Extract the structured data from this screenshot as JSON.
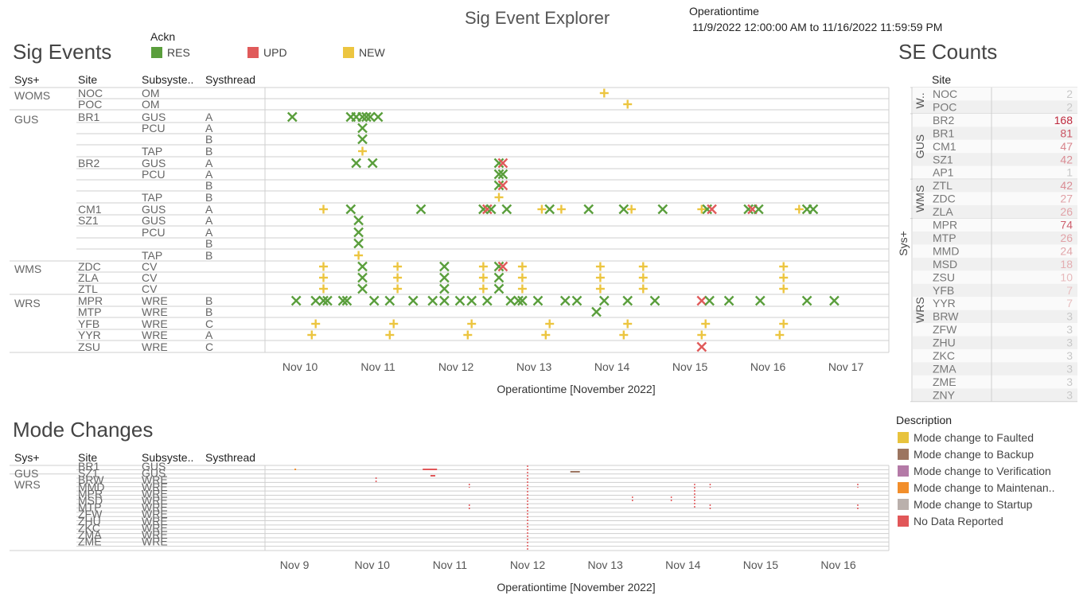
{
  "header": {
    "title": "Sig Event Explorer",
    "range_label": "Operationtime",
    "range_value": "11/9/2022 12:00:00 AM to 11/16/2022 11:59:59 PM"
  },
  "sig_events": {
    "title": "Sig Events",
    "legend_title": "Ackn",
    "legend": [
      {
        "name": "RES",
        "color": "#5a9e3c"
      },
      {
        "name": "UPD",
        "color": "#e05a5a"
      },
      {
        "name": "NEW",
        "color": "#ecc540"
      }
    ],
    "columns": [
      "Sys+",
      "Site",
      "Subsyste..",
      "Systhread"
    ],
    "rows": [
      {
        "sys": "WOMS",
        "site": "NOC",
        "sub": "OM",
        "thr": ""
      },
      {
        "sys": "",
        "site": "POC",
        "sub": "OM",
        "thr": ""
      },
      {
        "sys": "GUS",
        "site": "BR1",
        "sub": "GUS",
        "thr": "A"
      },
      {
        "sys": "",
        "site": "",
        "sub": "PCU",
        "thr": "A"
      },
      {
        "sys": "",
        "site": "",
        "sub": "",
        "thr": "B"
      },
      {
        "sys": "",
        "site": "",
        "sub": "TAP",
        "thr": "B"
      },
      {
        "sys": "",
        "site": "BR2",
        "sub": "GUS",
        "thr": "A"
      },
      {
        "sys": "",
        "site": "",
        "sub": "PCU",
        "thr": "A"
      },
      {
        "sys": "",
        "site": "",
        "sub": "",
        "thr": "B"
      },
      {
        "sys": "",
        "site": "",
        "sub": "TAP",
        "thr": "B"
      },
      {
        "sys": "",
        "site": "CM1",
        "sub": "GUS",
        "thr": "A"
      },
      {
        "sys": "",
        "site": "SZ1",
        "sub": "GUS",
        "thr": "A"
      },
      {
        "sys": "",
        "site": "",
        "sub": "PCU",
        "thr": "A"
      },
      {
        "sys": "",
        "site": "",
        "sub": "",
        "thr": "B"
      },
      {
        "sys": "",
        "site": "",
        "sub": "TAP",
        "thr": "B"
      },
      {
        "sys": "WMS",
        "site": "ZDC",
        "sub": "CV",
        "thr": ""
      },
      {
        "sys": "",
        "site": "ZLA",
        "sub": "CV",
        "thr": ""
      },
      {
        "sys": "",
        "site": "ZTL",
        "sub": "CV",
        "thr": ""
      },
      {
        "sys": "WRS",
        "site": "MPR",
        "sub": "WRE",
        "thr": "B"
      },
      {
        "sys": "",
        "site": "MTP",
        "sub": "WRE",
        "thr": "B"
      },
      {
        "sys": "",
        "site": "YFB",
        "sub": "WRE",
        "thr": "C"
      },
      {
        "sys": "",
        "site": "YYR",
        "sub": "WRE",
        "thr": "A"
      },
      {
        "sys": "",
        "site": "ZSU",
        "sub": "WRE",
        "thr": "C"
      }
    ],
    "axis_title": "Operationtime [November 2022]",
    "ticks": [
      "Nov 10",
      "Nov 11",
      "Nov 12",
      "Nov 13",
      "Nov 14",
      "Nov 15",
      "Nov 16",
      "Nov 17"
    ]
  },
  "chart_data": [
    {
      "type": "scatter",
      "title": "Sig Events",
      "xlabel": "Operationtime [November 2022]",
      "x_range_days": [
        9.55,
        17.55
      ],
      "note_x": "day of November 2022",
      "points": [
        {
          "row": 0,
          "x": 13.9,
          "ack": "NEW"
        },
        {
          "row": 1,
          "x": 14.2,
          "ack": "NEW"
        },
        {
          "row": 2,
          "x": 9.9,
          "ack": "RES"
        },
        {
          "row": 2,
          "x": 10.65,
          "ack": "RES"
        },
        {
          "row": 2,
          "x": 10.72,
          "ack": "RES"
        },
        {
          "row": 2,
          "x": 10.8,
          "ack": "RES"
        },
        {
          "row": 2,
          "x": 10.85,
          "ack": "RES"
        },
        {
          "row": 2,
          "x": 10.9,
          "ack": "RES"
        },
        {
          "row": 2,
          "x": 11.0,
          "ack": "RES"
        },
        {
          "row": 3,
          "x": 10.8,
          "ack": "RES"
        },
        {
          "row": 4,
          "x": 10.8,
          "ack": "RES"
        },
        {
          "row": 5,
          "x": 10.8,
          "ack": "NEW"
        },
        {
          "row": 6,
          "x": 10.72,
          "ack": "RES"
        },
        {
          "row": 6,
          "x": 10.93,
          "ack": "RES"
        },
        {
          "row": 6,
          "x": 12.55,
          "ack": "RES"
        },
        {
          "row": 6,
          "x": 12.6,
          "ack": "UPD"
        },
        {
          "row": 7,
          "x": 12.55,
          "ack": "RES"
        },
        {
          "row": 7,
          "x": 12.6,
          "ack": "RES"
        },
        {
          "row": 8,
          "x": 12.55,
          "ack": "RES"
        },
        {
          "row": 8,
          "x": 12.6,
          "ack": "UPD"
        },
        {
          "row": 9,
          "x": 12.55,
          "ack": "NEW"
        },
        {
          "row": 10,
          "x": 10.3,
          "ack": "NEW"
        },
        {
          "row": 10,
          "x": 10.65,
          "ack": "RES"
        },
        {
          "row": 10,
          "x": 11.55,
          "ack": "RES"
        },
        {
          "row": 10,
          "x": 12.35,
          "ack": "RES"
        },
        {
          "row": 10,
          "x": 12.4,
          "ack": "UPD"
        },
        {
          "row": 10,
          "x": 12.45,
          "ack": "RES"
        },
        {
          "row": 10,
          "x": 12.65,
          "ack": "RES"
        },
        {
          "row": 10,
          "x": 13.1,
          "ack": "NEW"
        },
        {
          "row": 10,
          "x": 13.2,
          "ack": "RES"
        },
        {
          "row": 10,
          "x": 13.35,
          "ack": "NEW"
        },
        {
          "row": 10,
          "x": 13.7,
          "ack": "RES"
        },
        {
          "row": 10,
          "x": 14.15,
          "ack": "RES"
        },
        {
          "row": 10,
          "x": 14.25,
          "ack": "NEW"
        },
        {
          "row": 10,
          "x": 14.65,
          "ack": "RES"
        },
        {
          "row": 10,
          "x": 15.15,
          "ack": "NEW"
        },
        {
          "row": 10,
          "x": 15.22,
          "ack": "RES"
        },
        {
          "row": 10,
          "x": 15.28,
          "ack": "UPD"
        },
        {
          "row": 10,
          "x": 15.75,
          "ack": "RES"
        },
        {
          "row": 10,
          "x": 15.8,
          "ack": "UPD"
        },
        {
          "row": 10,
          "x": 15.88,
          "ack": "RES"
        },
        {
          "row": 10,
          "x": 16.4,
          "ack": "NEW"
        },
        {
          "row": 10,
          "x": 16.5,
          "ack": "RES"
        },
        {
          "row": 10,
          "x": 16.58,
          "ack": "RES"
        },
        {
          "row": 11,
          "x": 10.75,
          "ack": "RES"
        },
        {
          "row": 12,
          "x": 10.75,
          "ack": "RES"
        },
        {
          "row": 13,
          "x": 10.75,
          "ack": "RES"
        },
        {
          "row": 14,
          "x": 10.75,
          "ack": "NEW"
        },
        {
          "row": 15,
          "x": 10.3,
          "ack": "NEW"
        },
        {
          "row": 15,
          "x": 10.8,
          "ack": "RES"
        },
        {
          "row": 15,
          "x": 11.25,
          "ack": "NEW"
        },
        {
          "row": 15,
          "x": 11.85,
          "ack": "RES"
        },
        {
          "row": 15,
          "x": 12.35,
          "ack": "NEW"
        },
        {
          "row": 15,
          "x": 12.55,
          "ack": "RES"
        },
        {
          "row": 15,
          "x": 12.6,
          "ack": "UPD"
        },
        {
          "row": 15,
          "x": 12.85,
          "ack": "NEW"
        },
        {
          "row": 15,
          "x": 13.85,
          "ack": "NEW"
        },
        {
          "row": 15,
          "x": 14.4,
          "ack": "NEW"
        },
        {
          "row": 15,
          "x": 16.2,
          "ack": "NEW"
        },
        {
          "row": 16,
          "x": 10.3,
          "ack": "NEW"
        },
        {
          "row": 16,
          "x": 10.8,
          "ack": "RES"
        },
        {
          "row": 16,
          "x": 11.25,
          "ack": "NEW"
        },
        {
          "row": 16,
          "x": 11.85,
          "ack": "RES"
        },
        {
          "row": 16,
          "x": 12.35,
          "ack": "NEW"
        },
        {
          "row": 16,
          "x": 12.55,
          "ack": "RES"
        },
        {
          "row": 16,
          "x": 12.85,
          "ack": "NEW"
        },
        {
          "row": 16,
          "x": 13.85,
          "ack": "NEW"
        },
        {
          "row": 16,
          "x": 14.4,
          "ack": "NEW"
        },
        {
          "row": 16,
          "x": 16.2,
          "ack": "NEW"
        },
        {
          "row": 17,
          "x": 10.3,
          "ack": "NEW"
        },
        {
          "row": 17,
          "x": 10.8,
          "ack": "RES"
        },
        {
          "row": 17,
          "x": 11.25,
          "ack": "NEW"
        },
        {
          "row": 17,
          "x": 11.85,
          "ack": "RES"
        },
        {
          "row": 17,
          "x": 12.35,
          "ack": "NEW"
        },
        {
          "row": 17,
          "x": 12.55,
          "ack": "RES"
        },
        {
          "row": 17,
          "x": 12.85,
          "ack": "NEW"
        },
        {
          "row": 17,
          "x": 13.85,
          "ack": "NEW"
        },
        {
          "row": 17,
          "x": 14.4,
          "ack": "NEW"
        },
        {
          "row": 17,
          "x": 16.2,
          "ack": "NEW"
        },
        {
          "row": 18,
          "x": 9.95,
          "ack": "RES"
        },
        {
          "row": 18,
          "x": 10.2,
          "ack": "RES"
        },
        {
          "row": 18,
          "x": 10.3,
          "ack": "RES"
        },
        {
          "row": 18,
          "x": 10.35,
          "ack": "RES"
        },
        {
          "row": 18,
          "x": 10.55,
          "ack": "RES"
        },
        {
          "row": 18,
          "x": 10.6,
          "ack": "RES"
        },
        {
          "row": 18,
          "x": 10.95,
          "ack": "RES"
        },
        {
          "row": 18,
          "x": 11.15,
          "ack": "RES"
        },
        {
          "row": 18,
          "x": 11.45,
          "ack": "RES"
        },
        {
          "row": 18,
          "x": 11.7,
          "ack": "RES"
        },
        {
          "row": 18,
          "x": 11.85,
          "ack": "RES"
        },
        {
          "row": 18,
          "x": 12.05,
          "ack": "RES"
        },
        {
          "row": 18,
          "x": 12.2,
          "ack": "RES"
        },
        {
          "row": 18,
          "x": 12.4,
          "ack": "RES"
        },
        {
          "row": 18,
          "x": 12.7,
          "ack": "RES"
        },
        {
          "row": 18,
          "x": 12.8,
          "ack": "RES"
        },
        {
          "row": 18,
          "x": 12.85,
          "ack": "RES"
        },
        {
          "row": 18,
          "x": 13.05,
          "ack": "RES"
        },
        {
          "row": 18,
          "x": 13.4,
          "ack": "RES"
        },
        {
          "row": 18,
          "x": 13.55,
          "ack": "RES"
        },
        {
          "row": 18,
          "x": 13.9,
          "ack": "RES"
        },
        {
          "row": 18,
          "x": 14.2,
          "ack": "RES"
        },
        {
          "row": 18,
          "x": 14.55,
          "ack": "RES"
        },
        {
          "row": 18,
          "x": 15.15,
          "ack": "UPD"
        },
        {
          "row": 18,
          "x": 15.25,
          "ack": "RES"
        },
        {
          "row": 18,
          "x": 15.5,
          "ack": "RES"
        },
        {
          "row": 18,
          "x": 15.9,
          "ack": "RES"
        },
        {
          "row": 18,
          "x": 16.5,
          "ack": "RES"
        },
        {
          "row": 18,
          "x": 16.85,
          "ack": "RES"
        },
        {
          "row": 19,
          "x": 13.8,
          "ack": "RES"
        },
        {
          "row": 20,
          "x": 10.2,
          "ack": "NEW"
        },
        {
          "row": 20,
          "x": 11.2,
          "ack": "NEW"
        },
        {
          "row": 20,
          "x": 12.2,
          "ack": "NEW"
        },
        {
          "row": 20,
          "x": 13.2,
          "ack": "NEW"
        },
        {
          "row": 20,
          "x": 14.2,
          "ack": "NEW"
        },
        {
          "row": 20,
          "x": 15.2,
          "ack": "NEW"
        },
        {
          "row": 20,
          "x": 16.2,
          "ack": "NEW"
        },
        {
          "row": 21,
          "x": 10.15,
          "ack": "NEW"
        },
        {
          "row": 21,
          "x": 11.15,
          "ack": "NEW"
        },
        {
          "row": 21,
          "x": 12.15,
          "ack": "NEW"
        },
        {
          "row": 21,
          "x": 13.15,
          "ack": "NEW"
        },
        {
          "row": 21,
          "x": 14.15,
          "ack": "NEW"
        },
        {
          "row": 21,
          "x": 15.15,
          "ack": "NEW"
        },
        {
          "row": 21,
          "x": 16.15,
          "ack": "NEW"
        },
        {
          "row": 22,
          "x": 15.15,
          "ack": "UPD"
        }
      ]
    },
    {
      "type": "bar",
      "title": "SE Counts",
      "categories": [
        "NOC",
        "POC",
        "BR2",
        "BR1",
        "CM1",
        "SZ1",
        "AP1",
        "ZTL",
        "ZDC",
        "ZLA",
        "MPR",
        "MTP",
        "MMD",
        "MSD",
        "ZSU",
        "YFB",
        "YYR",
        "BRW",
        "ZFW",
        "ZHU",
        "ZKC",
        "ZMA",
        "ZME",
        "ZNY"
      ],
      "values": [
        2,
        2,
        168,
        81,
        47,
        42,
        1,
        42,
        27,
        26,
        74,
        26,
        24,
        18,
        10,
        7,
        7,
        3,
        3,
        3,
        3,
        3,
        3,
        3
      ]
    },
    {
      "type": "scatter",
      "title": "Mode Changes",
      "xlabel": "Operationtime [November 2022]"
    }
  ],
  "se_counts": {
    "title": "SE Counts",
    "site_header": "Site",
    "axis_label": "Sys+",
    "groups": [
      {
        "name": "W..",
        "rows": [
          {
            "site": "NOC",
            "count": "2"
          },
          {
            "site": "POC",
            "count": "2"
          }
        ]
      },
      {
        "name": "GUS",
        "rows": [
          {
            "site": "BR2",
            "count": "168"
          },
          {
            "site": "BR1",
            "count": "81"
          },
          {
            "site": "CM1",
            "count": "47"
          },
          {
            "site": "SZ1",
            "count": "42"
          },
          {
            "site": "AP1",
            "count": "1"
          }
        ]
      },
      {
        "name": "WMS",
        "rows": [
          {
            "site": "ZTL",
            "count": "42"
          },
          {
            "site": "ZDC",
            "count": "27"
          },
          {
            "site": "ZLA",
            "count": "26"
          }
        ]
      },
      {
        "name": "WRS",
        "rows": [
          {
            "site": "MPR",
            "count": "74"
          },
          {
            "site": "MTP",
            "count": "26"
          },
          {
            "site": "MMD",
            "count": "24"
          },
          {
            "site": "MSD",
            "count": "18"
          },
          {
            "site": "ZSU",
            "count": "10"
          },
          {
            "site": "YFB",
            "count": "7"
          },
          {
            "site": "YYR",
            "count": "7"
          },
          {
            "site": "BRW",
            "count": "3"
          },
          {
            "site": "ZFW",
            "count": "3"
          },
          {
            "site": "ZHU",
            "count": "3"
          },
          {
            "site": "ZKC",
            "count": "3"
          },
          {
            "site": "ZMA",
            "count": "3"
          },
          {
            "site": "ZME",
            "count": "3"
          },
          {
            "site": "ZNY",
            "count": "3"
          }
        ]
      }
    ]
  },
  "mode_changes": {
    "title": "Mode Changes",
    "columns": [
      "Sys+",
      "Site",
      "Subsyste..",
      "Systhread"
    ],
    "groups": [
      "GUS",
      "WRS"
    ],
    "sites": [
      "BR1",
      "SZ1",
      "BRW",
      "MMD",
      "MPR",
      "MSD",
      "MTP",
      "ZFW",
      "ZHU",
      "ZKC",
      "ZMA",
      "ZME"
    ],
    "subs": [
      "GUS",
      "GUS",
      "WRE",
      "WRE",
      "WRE",
      "WRE",
      "WRE",
      "WRE",
      "WRE",
      "WRE",
      "WRE",
      "WRE"
    ],
    "axis_title": "Operationtime [November 2022]",
    "ticks": [
      "Nov 9",
      "Nov 10",
      "Nov 11",
      "Nov 12",
      "Nov 13",
      "Nov 14",
      "Nov 15",
      "Nov 16"
    ]
  },
  "description_legend": {
    "title": "Description",
    "items": [
      {
        "label": "Mode change to Faulted",
        "color": "#e8c33d"
      },
      {
        "label": "Mode change to Backup",
        "color": "#9c7560"
      },
      {
        "label": "Mode change to Verification",
        "color": "#b47aa7"
      },
      {
        "label": "Mode change to Maintenan..",
        "color": "#f28e2b"
      },
      {
        "label": "Mode change to Startup",
        "color": "#bab0ac"
      },
      {
        "label": "No Data Reported",
        "color": "#e15759"
      }
    ]
  }
}
